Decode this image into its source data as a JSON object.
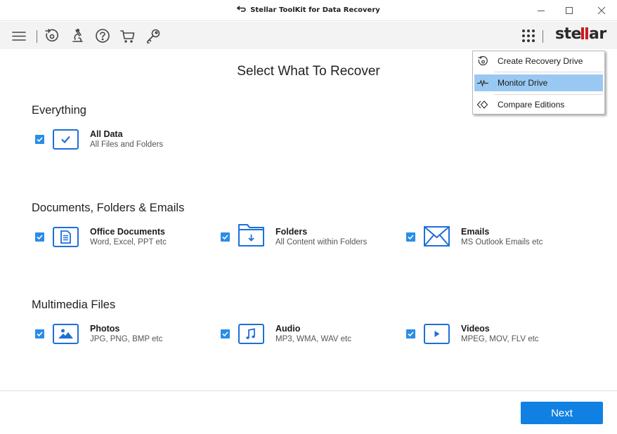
{
  "window": {
    "title": "Stellar ToolKit for Data Recovery",
    "app_icon": "swap-arrows-icon",
    "controls": [
      "minimize",
      "maximize",
      "close"
    ]
  },
  "toolbar": {
    "left_icons": [
      "menu-icon",
      "recovery-drive-icon",
      "microscope-icon",
      "help-icon",
      "cart-icon",
      "key-icon"
    ],
    "right_icons": [
      "apps-grid-icon"
    ],
    "logo_text_pre": "ste",
    "logo_text_post": "ar",
    "brand_color": "#d0181f"
  },
  "page": {
    "title": "Select What To Recover"
  },
  "sections": [
    {
      "title": "Everything",
      "items": [
        {
          "label": "All Data",
          "sub": "All Files and Folders",
          "icon": "check-box-icon",
          "checked": true
        }
      ]
    },
    {
      "title": "Documents, Folders & Emails",
      "items": [
        {
          "label": "Office Documents",
          "sub": "Word, Excel, PPT etc",
          "icon": "document-icon",
          "checked": true
        },
        {
          "label": "Folders",
          "sub": "All Content within Folders",
          "icon": "folder-icon",
          "checked": true
        },
        {
          "label": "Emails",
          "sub": "MS Outlook Emails etc",
          "icon": "envelope-icon",
          "checked": true
        }
      ]
    },
    {
      "title": "Multimedia Files",
      "items": [
        {
          "label": "Photos",
          "sub": "JPG, PNG, BMP etc",
          "icon": "photo-icon",
          "checked": true
        },
        {
          "label": "Audio",
          "sub": "MP3, WMA, WAV etc",
          "icon": "music-note-icon",
          "checked": true
        },
        {
          "label": "Videos",
          "sub": "MPEG, MOV, FLV etc",
          "icon": "play-icon",
          "checked": true
        }
      ]
    }
  ],
  "menu": {
    "items": [
      {
        "label": "Create Recovery Drive",
        "icon": "recovery-drive-icon",
        "active": false
      },
      {
        "label": "Monitor Drive",
        "icon": "pulse-icon",
        "active": true
      },
      {
        "label": "Compare Editions",
        "icon": "compare-icon",
        "active": false
      }
    ]
  },
  "footer": {
    "next_label": "Next"
  },
  "colors": {
    "accent": "#1180e3",
    "checkbox": "#2b8de6",
    "icon_blue": "#1e6fd9",
    "menu_highlight": "#99c9f2"
  }
}
